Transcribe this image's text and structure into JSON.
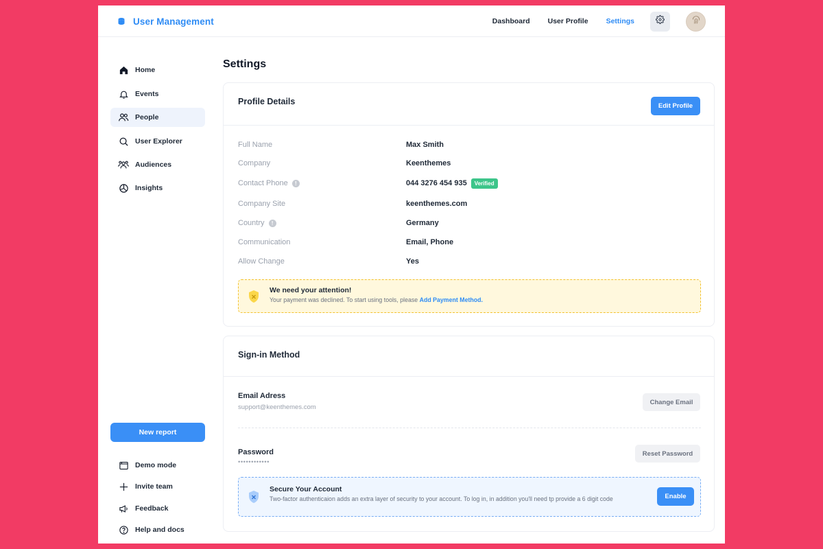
{
  "header": {
    "brand_title": "User Management",
    "nav": [
      "Dashboard",
      "User Profile",
      "Settings"
    ],
    "active_nav": "Settings"
  },
  "sidebar": {
    "items": [
      {
        "label": "Home",
        "icon": "home-icon"
      },
      {
        "label": "Events",
        "icon": "bell-icon"
      },
      {
        "label": "People",
        "icon": "people-icon",
        "active": true
      },
      {
        "label": "User Explorer",
        "icon": "search-icon"
      },
      {
        "label": "Audiences",
        "icon": "audiences-icon"
      },
      {
        "label": "Insights",
        "icon": "pie-chart-icon"
      }
    ],
    "new_report_label": "New report",
    "footer_items": [
      {
        "label": "Demo mode",
        "icon": "window-icon"
      },
      {
        "label": "Invite team",
        "icon": "plus-icon"
      },
      {
        "label": "Feedback",
        "icon": "megaphone-icon"
      },
      {
        "label": "Help and docs",
        "icon": "help-icon"
      }
    ]
  },
  "main": {
    "page_title": "Settings",
    "profile": {
      "title": "Profile Details",
      "edit_label": "Edit Profile",
      "fields": [
        {
          "key": "Full Name",
          "value": "Max Smith"
        },
        {
          "key": "Company",
          "value": "Keenthemes"
        },
        {
          "key": "Contact Phone",
          "value": "044 3276 454 935",
          "info": true,
          "badge": "Verified"
        },
        {
          "key": "Company Site",
          "value": "keenthemes.com"
        },
        {
          "key": "Country",
          "value": "Germany",
          "info": true
        },
        {
          "key": "Communication",
          "value": "Email, Phone"
        },
        {
          "key": "Allow Change",
          "value": "Yes"
        }
      ],
      "notice": {
        "title": "We need your attention!",
        "text": "Your payment was declined. To start using tools, please ",
        "link": "Add Payment Method."
      }
    },
    "signin": {
      "title": "Sign-in Method",
      "email_label": "Email Adress",
      "email_value": "support@keenthemes.com",
      "change_email_label": "Change Email",
      "password_label": "Password",
      "password_value": "••••••••••••",
      "reset_password_label": "Reset Password",
      "secure": {
        "title": "Secure Your Account",
        "text": "Two-factor authenticaion adds an extra layer of security to your account. To log in, in addition you'll need tp provide a 6 digit code",
        "enable_label": "Enable"
      }
    }
  },
  "colors": {
    "background": "#f23b64",
    "accent": "#3a8ff6",
    "success": "#3dc58a",
    "warning": "#f3c12c"
  }
}
